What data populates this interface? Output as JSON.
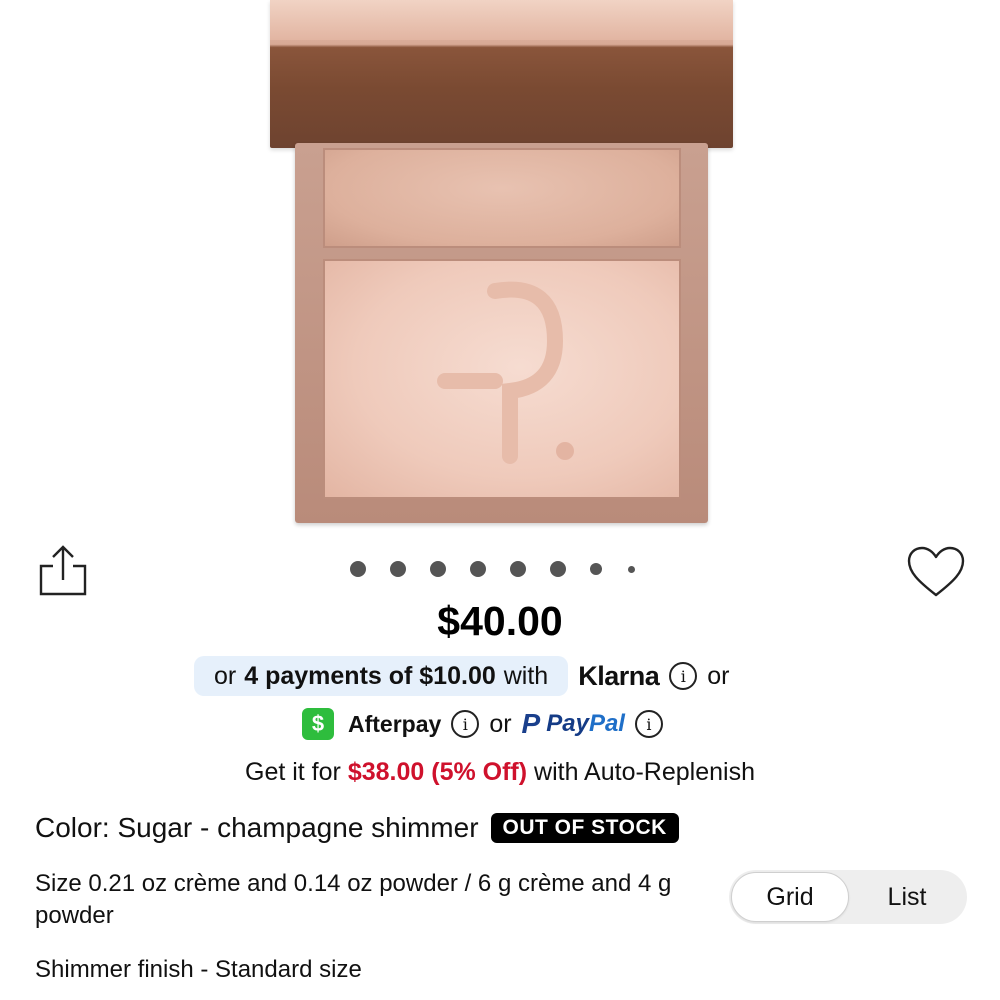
{
  "product": {
    "price": "$40.00",
    "carousel": {
      "total_slides": 8,
      "active_index": 0
    }
  },
  "payments": {
    "klarna_prefix": "or",
    "klarna_bold": "4 payments of $10.00",
    "klarna_suffix": "with",
    "klarna_brand": "Klarna",
    "after_klarna": "or",
    "afterpay_badge": "$",
    "afterpay_brand": "Afterpay",
    "between_or": "or",
    "paypal_mark": "P",
    "paypal_pay": "Pay",
    "paypal_pal": "Pal",
    "info_glyph": "i"
  },
  "replenish": {
    "prefix": "Get it for",
    "sale": "$38.00 (5% Off)",
    "suffix": "with Auto-Replenish"
  },
  "details": {
    "color": "Color: Sugar - champagne shimmer",
    "stock_badge": "OUT OF STOCK",
    "size": "Size 0.21 oz crème and 0.14 oz powder / 6 g crème and 4 g powder",
    "finish": "Shimmer finish - Standard size"
  },
  "view_toggle": {
    "options": [
      "Grid",
      "List"
    ],
    "selected": "Grid"
  },
  "icons": {
    "share": "share-icon",
    "wishlist": "heart-icon",
    "info": "info-icon"
  },
  "colors": {
    "sale_red": "#cf112c",
    "klarna_pill": "#e6f0fb",
    "afterpay_green": "#2ebd3d",
    "paypal_blue": "#1f6fc8"
  }
}
